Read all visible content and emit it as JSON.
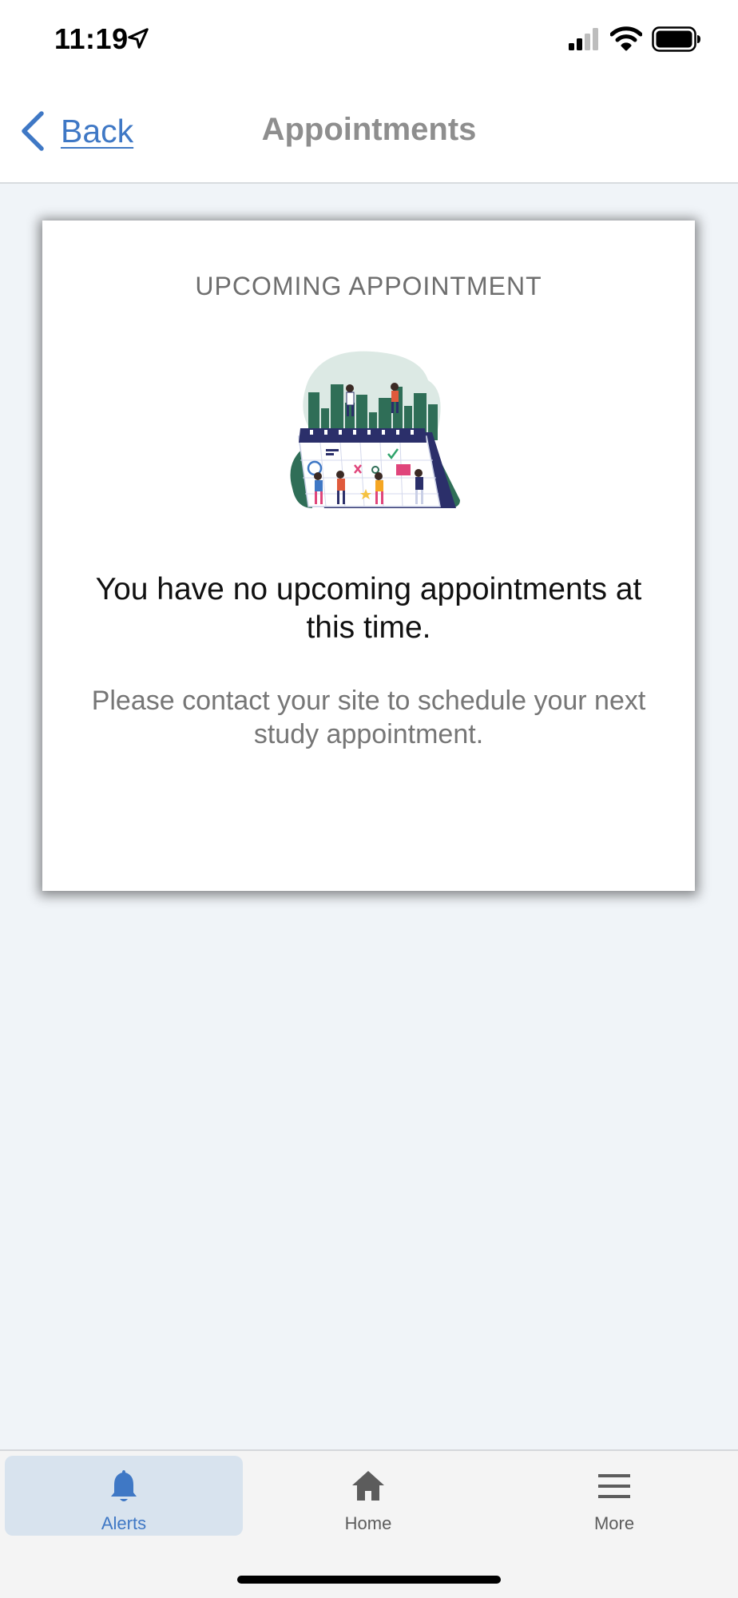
{
  "status_bar": {
    "time": "11:19"
  },
  "nav": {
    "back_label": "Back",
    "title": "Appointments"
  },
  "card": {
    "heading": "UPCOMING APPOINTMENT",
    "message": "You have no upcoming appointments at this time.",
    "subtext": "Please contact your site to schedule your next study appointment."
  },
  "tabs": [
    {
      "label": "Alerts",
      "icon": "bell-icon",
      "active": true
    },
    {
      "label": "Home",
      "icon": "home-icon",
      "active": false
    },
    {
      "label": "More",
      "icon": "menu-icon",
      "active": false
    }
  ],
  "colors": {
    "accent": "#3f78c5",
    "active_tab_bg": "#d8e3ee",
    "page_bg": "#f0f4f8"
  }
}
